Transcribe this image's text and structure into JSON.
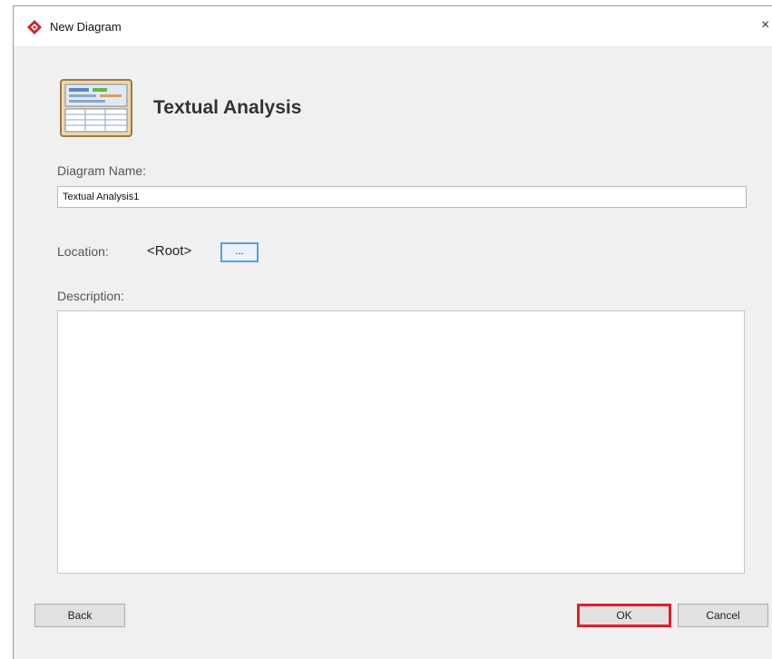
{
  "window": {
    "title": "New Diagram",
    "close_glyph": "×",
    "app_icon": "diamond-logo-icon"
  },
  "header": {
    "title": "Textual Analysis",
    "icon": "textual-analysis-thumbnail-icon"
  },
  "form": {
    "name_label": "Diagram Name:",
    "name_value": "Textual Analysis1",
    "location_label": "Location:",
    "location_value": "<Root>",
    "browse_label": "...",
    "description_label": "Description:",
    "description_value": ""
  },
  "buttons": {
    "back": "Back",
    "ok": "OK",
    "cancel": "Cancel"
  },
  "colors": {
    "highlight": "#e0202a",
    "focus_border": "#5a9fdc"
  }
}
